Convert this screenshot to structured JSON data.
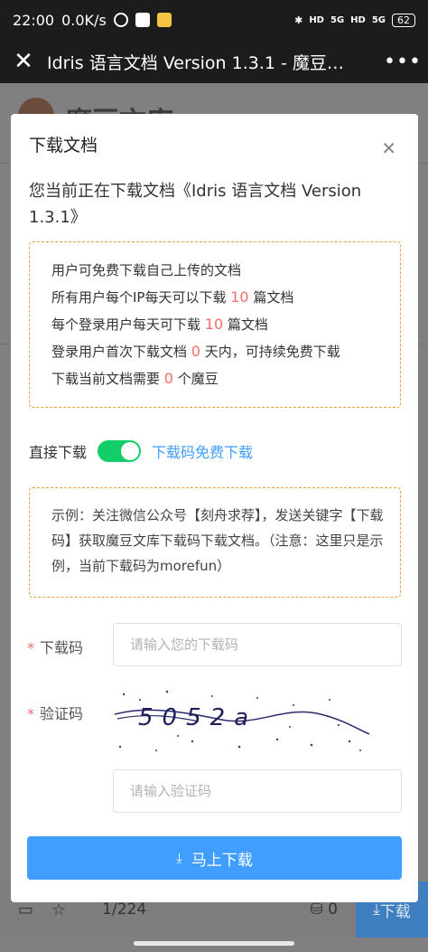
{
  "status_bar": {
    "time": "22:00",
    "speed": "0.0K/s",
    "battery": "62",
    "network_a": "5G",
    "network_b": "5G",
    "hd_a": "HD",
    "hd_b": "HD"
  },
  "app_bar": {
    "title": "Idris 语言文档 Version 1.3.1 - 魔豆…",
    "close_icon": "close-icon",
    "more_icon": "more-icon"
  },
  "background": {
    "logo_text": "魔豆文库",
    "page_indicator": "1/224",
    "coins": "0",
    "download_label": "下载"
  },
  "modal": {
    "title": "下载文档",
    "description": "您当前正在下载文档《Idris 语言文档 Version 1.3.1》",
    "info_lines": [
      {
        "pre": "用户可免费下载自己上传的文档",
        "num": "",
        "post": ""
      },
      {
        "pre": "所有用户每个IP每天可以下载 ",
        "num": "10",
        "post": " 篇文档"
      },
      {
        "pre": "每个登录用户每天可下载 ",
        "num": "10",
        "post": " 篇文档"
      },
      {
        "pre": "登录用户首次下载文档 ",
        "num": "0",
        "post": " 天内，可持续免费下载"
      },
      {
        "pre": "下载当前文档需要 ",
        "num": "0",
        "post": " 个魔豆"
      }
    ],
    "toggle": {
      "label": "直接下载",
      "state": "on",
      "alt_label": "下载码免费下载"
    },
    "example_text": "示例：关注微信公众号【刻舟求荐】，发送关键字【下载码】获取魔豆文库下载码下载文档。（注意：这里只是示例，当前下载码为morefun）",
    "form": {
      "code_label": "下载码",
      "code_placeholder": "请输入您的下载码",
      "captcha_label": "验证码",
      "captcha_text": "5052a",
      "captcha_placeholder": "请输入验证码",
      "required_mark": "*"
    },
    "submit_label": "马上下载"
  },
  "colors": {
    "primary": "#409eff",
    "switch_on": "#13ce66",
    "warning_border": "#e6a23c",
    "danger": "#f56c6c"
  }
}
